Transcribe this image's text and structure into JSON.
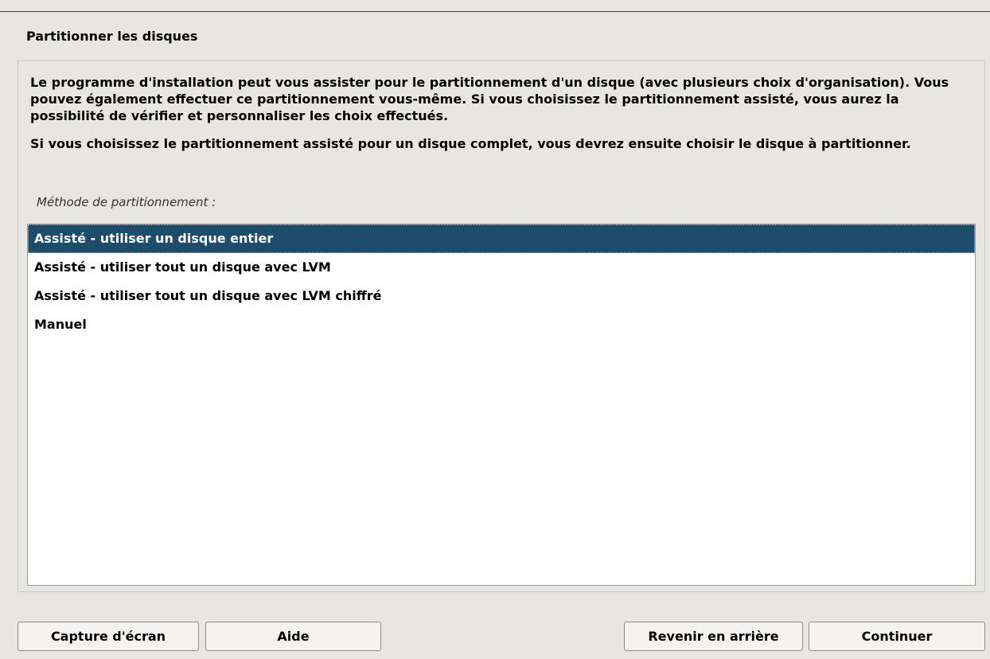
{
  "window": {
    "title": "Partitionner les disques"
  },
  "description": {
    "paragraph1": "Le programme d'installation peut vous assister pour le partitionnement d'un disque (avec plusieurs choix d'organisation). Vous pouvez également effectuer ce partitionnement vous-même. Si vous choisissez le partitionnement assisté, vous aurez la possibilité de vérifier et personnaliser les choix effectués.",
    "paragraph2": "Si vous choisissez le partitionnement assisté pour un disque complet, vous devrez ensuite choisir le disque à partitionner."
  },
  "method": {
    "label": "Méthode de partitionnement :",
    "options": [
      {
        "label": "Assisté - utiliser un disque entier",
        "selected": true
      },
      {
        "label": "Assisté - utiliser tout un disque avec LVM",
        "selected": false
      },
      {
        "label": "Assisté - utiliser tout un disque avec LVM chiffré",
        "selected": false
      },
      {
        "label": "Manuel",
        "selected": false
      }
    ]
  },
  "buttons": {
    "screenshot": "Capture d'écran",
    "help": "Aide",
    "back": "Revenir en arrière",
    "continue": "Continuer"
  },
  "colors": {
    "selection": "#1e4d6b",
    "background": "#e8e6e3"
  }
}
